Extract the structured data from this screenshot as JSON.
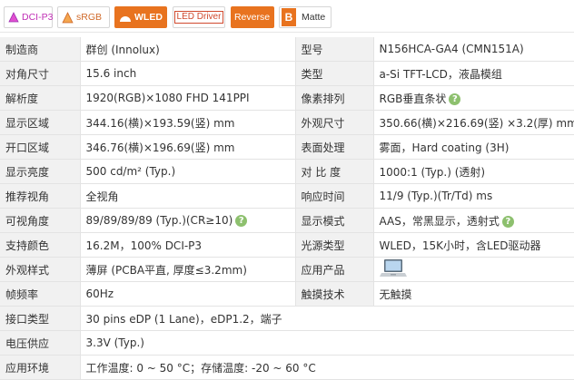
{
  "badges": {
    "dcip3": "DCI-P3",
    "srgb": "sRGB",
    "wled": "WLED",
    "led_driver": "LED Driver",
    "reverse": "Reverse",
    "matte": "Matte",
    "matte_icon": "B"
  },
  "colors": {
    "label_bg": "#f1f1f1",
    "border": "#e3e3e3",
    "accent_orange": "#e8731f",
    "help_green": "#8dc06e"
  },
  "specs": {
    "manufacturer": {
      "label": "制造商",
      "value": "群创 (Innolux)"
    },
    "model": {
      "label": "型号",
      "value": "N156HCA-GA4 (CMN151A)"
    },
    "diagonal": {
      "label": "对角尺寸",
      "value": "15.6 inch"
    },
    "panel_type": {
      "label": "类型",
      "value": "a-Si TFT-LCD，液晶模组"
    },
    "resolution": {
      "label": "解析度",
      "value": "1920(RGB)×1080   FHD   141PPI"
    },
    "pixel_arrangement": {
      "label": "像素排列",
      "value": "RGB垂直条状"
    },
    "display_area": {
      "label": "显示区域",
      "value": "344.16(横)×193.59(竖) mm"
    },
    "outline": {
      "label": "外观尺寸",
      "value": "350.66(横)×216.69(竖) ×3.2(厚) mm"
    },
    "opening_area": {
      "label": "开口区域",
      "value": "346.76(横)×196.69(竖) mm"
    },
    "surface": {
      "label": "表面处理",
      "value": "雾面，Hard coating (3H)"
    },
    "brightness": {
      "label": "显示亮度",
      "value": "500 cd/m² (Typ.)"
    },
    "contrast": {
      "label": "对 比 度",
      "value": "1000:1 (Typ.) (透射)"
    },
    "view_direction": {
      "label": "推荐视角",
      "value": "全视角"
    },
    "response": {
      "label": "响应时间",
      "value": "11/9 (Typ.)(Tr/Td) ms"
    },
    "view_angle": {
      "label": "可视角度",
      "value": "89/89/89/89 (Typ.)(CR≥10)"
    },
    "display_mode": {
      "label": "显示模式",
      "value": "AAS，常黑显示，透射式"
    },
    "colors_support": {
      "label": "支持颜色",
      "value": "16.2M，100% DCI-P3"
    },
    "backlight": {
      "label": "光源类型",
      "value": "WLED，15K小时，含LED驱动器"
    },
    "appearance": {
      "label": "外观样式",
      "value": "薄屏 (PCBA平直, 厚度≤3.2mm)"
    },
    "application": {
      "label": "应用产品"
    },
    "refresh": {
      "label": "帧频率",
      "value": "60Hz"
    },
    "touch": {
      "label": "触摸技术",
      "value": "无触摸"
    },
    "interface": {
      "label": "接口类型",
      "value": "30 pins   eDP (1 Lane)，eDP1.2，端子"
    },
    "voltage": {
      "label": "电压供应",
      "value": "3.3V (Typ.)"
    },
    "environment": {
      "label": "应用环境",
      "value": "工作温度: 0 ~ 50 °C；存储温度: -20 ~ 60 °C"
    }
  },
  "icons": {
    "help": "question-mark-icon",
    "application": "laptop-icon"
  }
}
